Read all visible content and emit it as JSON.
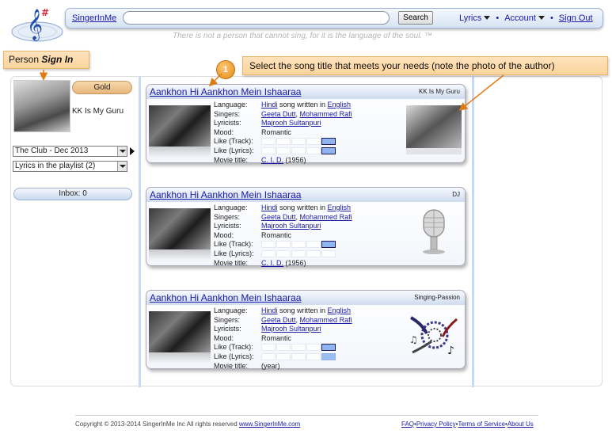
{
  "header": {
    "brand": "SingerInMe",
    "search_value": "",
    "search_button": "Search",
    "menu": {
      "lyrics": "Lyrics",
      "account": "Account",
      "sign_out": "Sign Out"
    },
    "slogan": "There is not a person that cannot sing, for it is the language of the soul. ™"
  },
  "callouts": {
    "person_prefix": "Person ",
    "person_bold": "Sign In",
    "select_text": "Select the song title that meets your needs (note the photo of the author)",
    "step_number": "1"
  },
  "sidebar": {
    "level": "Gold",
    "user_name": "KK Is My Guru",
    "club_select": "The Club - Dec 2013",
    "playlist_select": "Lyrics in the playlist (2)",
    "inbox": "Inbox: 0"
  },
  "labels": {
    "language": "Language:",
    "singers": "Singers:",
    "lyricists": "Lyricists:",
    "mood": "Mood:",
    "like_track": "Like (Track):",
    "like_lyrics": "Like (Lyrics):",
    "movie_title": "Movie title:",
    "song_written_in": " song written in "
  },
  "songs": [
    {
      "title": "Aankhon Hi Aankhon Mein Ishaaraa",
      "author": "KK Is My Guru",
      "language": "Hindi",
      "written_in": "English",
      "singer1": "Geeta Dutt",
      "singer2": "Mohammed Rafi",
      "lyricist": "Majrooh Sultanpuri",
      "mood": "Romantic",
      "like_track_level": 5,
      "like_lyrics_level": 5,
      "movie": "C. I. D.",
      "year": "(1956)",
      "avatar": "author-photo"
    },
    {
      "title": "Aankhon Hi Aankhon Mein Ishaaraa",
      "author": "DJ",
      "language": "Hindi",
      "written_in": "English",
      "singer1": "Geeta Dutt",
      "singer2": "Mohammed Rafi",
      "lyricist": "Majrooh Sultanpuri",
      "mood": "Romantic",
      "like_track_level": 5,
      "like_lyrics_level": 0,
      "movie": "C. I. D.",
      "year": "(1956)",
      "avatar": "microphone"
    },
    {
      "title": "Aankhon Hi Aankhon Mein Ishaaraa",
      "author": "Singing-Passion",
      "language": "Hindi",
      "written_in": "English",
      "singer1": "Geeta Dutt",
      "singer2": "Mohammed Rafi",
      "lyricist": "Majrooh Sultanpuri",
      "mood": "Romantic",
      "like_track_level": 5,
      "like_lyrics_level": 5,
      "movie": "",
      "year": "(year)",
      "avatar": "music-art"
    }
  ],
  "footer": {
    "copyright": "Copyright © 2013-2014 SingerInMe Inc All rights reserved ",
    "site": "www.SingerInMe.com",
    "faq": "FAQ",
    "privacy": "Privacy Policy",
    "terms": "Terms of Service",
    "about": "About Us",
    "sep": "•"
  }
}
